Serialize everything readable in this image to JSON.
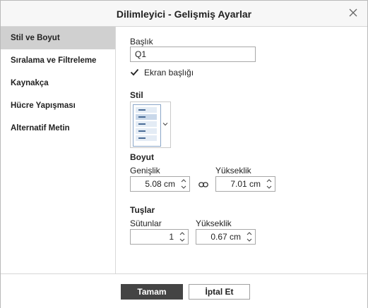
{
  "dialog": {
    "title": "Dilimleyici - Gelişmiş Ayarlar"
  },
  "sidebar": {
    "items": [
      {
        "label": "Stil ve Boyut",
        "active": true
      },
      {
        "label": "Sıralama ve Filtreleme",
        "active": false
      },
      {
        "label": "Kaynakça",
        "active": false
      },
      {
        "label": "Hücre Yapışması",
        "active": false
      },
      {
        "label": "Alternatif Metin",
        "active": false
      }
    ]
  },
  "content": {
    "header_label": "Başlık",
    "header_value": "Q1",
    "show_header_label": "Ekran başlığı",
    "show_header_checked": true,
    "style_label": "Stil",
    "size_label": "Boyut",
    "width_label": "Genişlik",
    "width_value": "5.08 cm",
    "height_label": "Yükseklik",
    "height_value": "7.01 cm",
    "buttons_label": "Tuşlar",
    "columns_label": "Sütunlar",
    "columns_value": "1",
    "button_height_label": "Yükseklik",
    "button_height_value": "0.67 cm"
  },
  "footer": {
    "ok_label": "Tamam",
    "cancel_label": "İptal Et"
  },
  "colors": {
    "primary_button": "#444444",
    "active_sidebar": "#d0d0d0"
  },
  "icons": {
    "close": "close-icon",
    "checkbox": "checkmark-icon",
    "link": "link-icon",
    "spinner": "spinner-arrows-icon",
    "dropdown": "chevron-down-icon"
  }
}
